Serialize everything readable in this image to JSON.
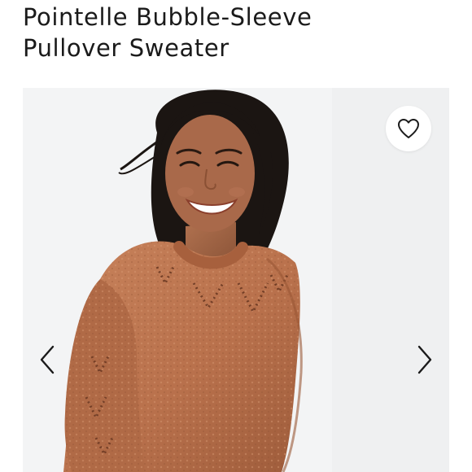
{
  "product": {
    "title_line1": "Pointelle Bubble-Sleeve",
    "title_line2": "Pullover Sweater"
  },
  "gallery": {
    "image_icon": "product-photo",
    "wishlist_icon": "heart-outline-icon",
    "prev_icon": "chevron-left-icon",
    "next_icon": "chevron-right-icon"
  },
  "colors": {
    "sweater": "#b9714c",
    "background": "#f2f3f4",
    "text": "#1a1a1a"
  }
}
